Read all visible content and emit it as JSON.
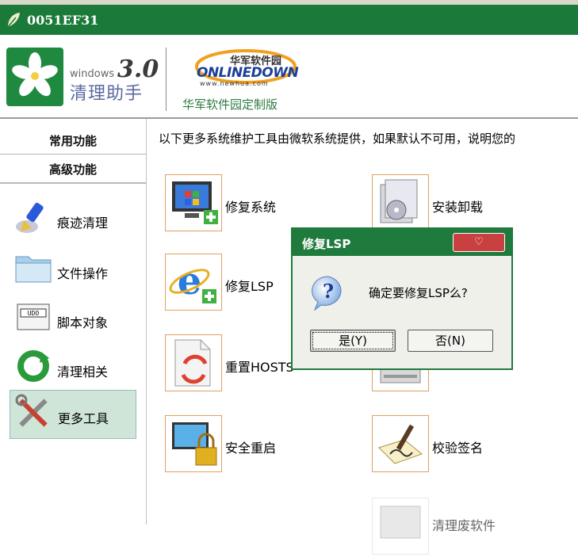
{
  "window": {
    "title": "0051EF31"
  },
  "header": {
    "windows_label": "windows",
    "version": "3.0",
    "product_name": "清理助手",
    "partner_cn": "华军软件园",
    "partner_en": "ONLINEDOWN",
    "partner_url": "www.newhua.com",
    "custom_label": "华军软件园定制版"
  },
  "sidebar": {
    "headers": [
      "常用功能",
      "高级功能"
    ],
    "items": [
      {
        "label": "痕迹清理",
        "icon": "broom-icon",
        "active": false
      },
      {
        "label": "文件操作",
        "icon": "folder-icon",
        "active": false
      },
      {
        "label": "脚本对象",
        "icon": "script-icon",
        "active": false
      },
      {
        "label": "清理相关",
        "icon": "refresh-icon",
        "active": false
      },
      {
        "label": "更多工具",
        "icon": "tools-icon",
        "active": true
      }
    ]
  },
  "main": {
    "info_text": "以下更多系统维护工具由微软系统提供，如果默认不可用，说明您的",
    "tools": [
      {
        "label": "修复系统",
        "icon": "repair-system-icon"
      },
      {
        "label": "安装卸载",
        "icon": "install-uninstall-icon"
      },
      {
        "label": "修复LSP",
        "icon": "repair-lsp-icon"
      },
      {
        "label": "重置HOSTS",
        "icon": "reset-hosts-icon"
      },
      {
        "label": "安全重启",
        "icon": "safe-restart-icon"
      },
      {
        "label": "校验签名",
        "icon": "verify-signature-icon"
      },
      {
        "label": "清理废软件",
        "icon": "cleanup-icon"
      }
    ]
  },
  "dialog": {
    "title": "修复LSP",
    "message": "确定要修复LSP么?",
    "yes_label": "是(Y)",
    "no_label": "否(N)"
  }
}
